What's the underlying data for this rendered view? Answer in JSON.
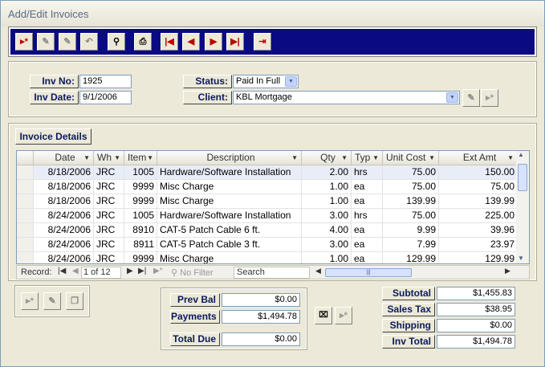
{
  "window": {
    "title": "Add/Edit Invoices"
  },
  "toolbar": {
    "buttons": [
      {
        "icon": "new-record-icon",
        "glyph": "▸*"
      },
      {
        "icon": "edit-icon",
        "glyph": "✎"
      },
      {
        "icon": "save-icon",
        "glyph": "✎"
      },
      {
        "icon": "undo-icon",
        "glyph": "↶"
      },
      {
        "icon": "find-binoculars-icon",
        "glyph": "⚲"
      },
      {
        "icon": "print-icon",
        "glyph": "⎙"
      },
      {
        "icon": "first-record-icon",
        "glyph": "|◀"
      },
      {
        "icon": "previous-record-icon",
        "glyph": "◀"
      },
      {
        "icon": "next-record-icon",
        "glyph": "▶"
      },
      {
        "icon": "last-record-icon",
        "glyph": "▶|"
      },
      {
        "icon": "exit-door-icon",
        "glyph": "⇥"
      }
    ]
  },
  "header": {
    "inv_no_label": "Inv No:",
    "inv_no_value": "1925",
    "inv_date_label": "Inv Date:",
    "inv_date_value": "9/1/2006",
    "status_label": "Status:",
    "status_value": "Paid In Full",
    "client_label": "Client:",
    "client_value": "KBL Mortgage"
  },
  "details": {
    "title": "Invoice Details",
    "columns": [
      "Date",
      "Wh",
      "Item",
      "Description",
      "Qty",
      "Typ",
      "Unit Cost",
      "Ext Amt"
    ],
    "rows": [
      [
        "8/18/2006",
        "JRC",
        "1005",
        "Hardware/Software Installation",
        "2.00",
        "hrs",
        "75.00",
        "150.00"
      ],
      [
        "8/18/2006",
        "JRC",
        "9999",
        "Misc Charge",
        "1.00",
        "ea",
        "75.00",
        "75.00"
      ],
      [
        "8/18/2006",
        "JRC",
        "9999",
        "Misc Charge",
        "1.00",
        "ea",
        "139.99",
        "139.99"
      ],
      [
        "8/24/2006",
        "JRC",
        "1005",
        "Hardware/Software Installation",
        "3.00",
        "hrs",
        "75.00",
        "225.00"
      ],
      [
        "8/24/2006",
        "JRC",
        "8910",
        "CAT-5 Patch Cable 6 ft.",
        "4.00",
        "ea",
        "9.99",
        "39.96"
      ],
      [
        "8/24/2006",
        "JRC",
        "8911",
        "CAT-5 Patch Cable 3 ft.",
        "3.00",
        "ea",
        "7.99",
        "23.97"
      ],
      [
        "8/24/2006",
        "JRC",
        "9999",
        "Misc Charge",
        "1.00",
        "ea",
        "129.99",
        "129.99"
      ]
    ],
    "nav": {
      "record_label": "Record:",
      "position": "1 of 12",
      "filter": "No Filter",
      "search": "Search"
    }
  },
  "totals": {
    "prev_bal_label": "Prev Bal",
    "prev_bal": "$0.00",
    "payments_label": "Payments",
    "payments": "$1,494.78",
    "total_due_label": "Total Due",
    "total_due": "$0.00",
    "subtotal_label": "Subtotal",
    "subtotal": "$1,455.83",
    "sales_tax_label": "Sales Tax",
    "sales_tax": "$38.95",
    "shipping_label": "Shipping",
    "shipping": "$0.00",
    "inv_total_label": "Inv Total",
    "inv_total": "$1,494.78"
  }
}
